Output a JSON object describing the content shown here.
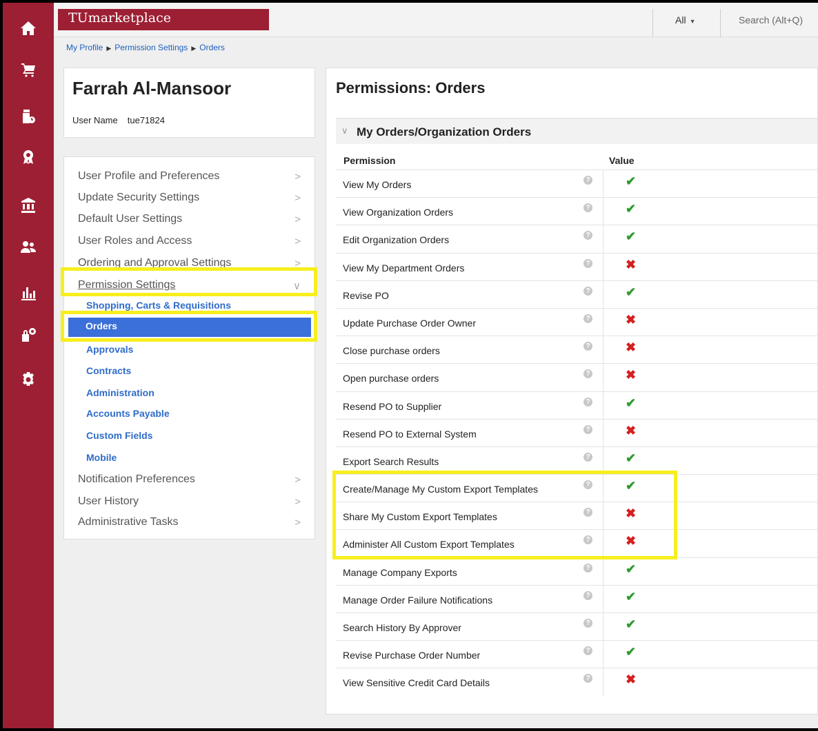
{
  "app": {
    "brand": "TUmarketplace",
    "scope": "All",
    "search_placeholder": "Search (Alt+Q)"
  },
  "rail_icons": [
    "home-icon",
    "cart-icon",
    "documents-clock-icon",
    "award-icon",
    "bank-icon",
    "users-icon",
    "bar-chart-icon",
    "lock-gear-icon",
    "gear-icon"
  ],
  "breadcrumb": [
    "My Profile",
    "Permission Settings",
    "Orders"
  ],
  "profile": {
    "name": "Farrah Al-Mansoor",
    "username_label": "User Name",
    "username": "tue71824"
  },
  "menu": {
    "items": [
      "User Profile and Preferences",
      "Update Security Settings",
      "Default User Settings",
      "User Roles and Access",
      "Ordering and Approval Settings",
      "Permission Settings"
    ],
    "sub_items": [
      "Shopping, Carts & Requisitions",
      "Orders",
      "Approvals",
      "Contracts",
      "Administration",
      "Accounts Payable",
      "Custom Fields",
      "Mobile"
    ],
    "items_after": [
      "Notification Preferences",
      "User History",
      "Administrative Tasks"
    ],
    "active_sub": "Orders"
  },
  "main": {
    "title": "Permissions:  Orders",
    "section": "My Orders/Organization Orders",
    "col_permission": "Permission",
    "col_value": "Value",
    "help_glyph": "?",
    "yes_glyph": "✔",
    "no_glyph": "✖",
    "rows": [
      {
        "label": "View My Orders",
        "value": true
      },
      {
        "label": "View Organization Orders",
        "value": true
      },
      {
        "label": "Edit Organization Orders",
        "value": true
      },
      {
        "label": "View My Department Orders",
        "value": false
      },
      {
        "label": "Revise PO",
        "value": true
      },
      {
        "label": "Update Purchase Order Owner",
        "value": false
      },
      {
        "label": "Close purchase orders",
        "value": false
      },
      {
        "label": "Open purchase orders",
        "value": false
      },
      {
        "label": "Resend PO to Supplier",
        "value": true
      },
      {
        "label": "Resend PO to External System",
        "value": false
      },
      {
        "label": "Export Search Results",
        "value": true
      },
      {
        "label": "Create/Manage My Custom Export Templates",
        "value": true
      },
      {
        "label": "Share My Custom Export Templates",
        "value": false
      },
      {
        "label": "Administer All Custom Export Templates",
        "value": false
      },
      {
        "label": "Manage Company Exports",
        "value": true
      },
      {
        "label": "Manage Order Failure Notifications",
        "value": true
      },
      {
        "label": "Search History By Approver",
        "value": true
      },
      {
        "label": "Revise Purchase Order Number",
        "value": true
      },
      {
        "label": "View Sensitive Credit Card Details",
        "value": false
      }
    ]
  },
  "colors": {
    "brand": "#9d1f33",
    "active": "#3b6fd9",
    "highlight": "#f7ef1d",
    "yes": "#2e9b2e",
    "no": "#d42020"
  }
}
